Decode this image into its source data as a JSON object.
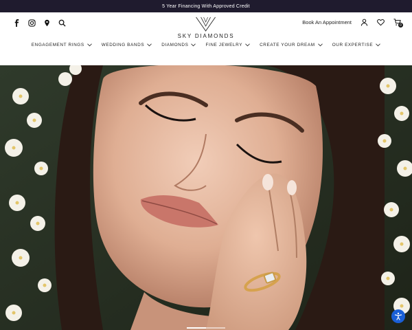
{
  "announcement": {
    "text": "5 Year Financing With Approved Credit"
  },
  "brand": {
    "name": "SKY DIAMONDS"
  },
  "social": {
    "icons": [
      "facebook-icon",
      "instagram-icon",
      "location-icon",
      "search-icon"
    ]
  },
  "header": {
    "appointment_label": "Book An Appointment",
    "cart_count": "0",
    "icons": [
      "account-icon",
      "wishlist-icon",
      "cart-icon"
    ]
  },
  "nav": {
    "items": [
      {
        "label": "ENGAGEMENT RINGS"
      },
      {
        "label": "WEDDING BANDS"
      },
      {
        "label": "DIAMONDS"
      },
      {
        "label": "FINE JEWELRY"
      },
      {
        "label": "CREATE YOUR DREAM"
      },
      {
        "label": "OUR EXPERTISE"
      }
    ]
  },
  "hero": {
    "slides_total": 2,
    "active_slide": 1
  },
  "colors": {
    "announcement_bg": "#1f1b2e",
    "accessibility_button": "#1a5fd6"
  }
}
